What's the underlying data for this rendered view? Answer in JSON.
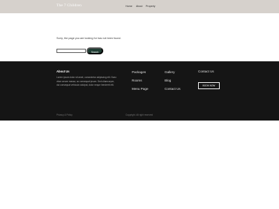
{
  "header": {
    "brand": "The 7 Children",
    "nav": {
      "home": "Home",
      "about": "About",
      "property": "Property"
    }
  },
  "main": {
    "not_found_message": "Sorry, the page you are looking for has not been found.",
    "search_button": "Search",
    "search_value": ""
  },
  "footer": {
    "about_title": "About Us",
    "about_text": "Lorem ipsum dolor sit amet, consectetur adipiscing elit. Nunc vitae ornare massa, ac consequat ipsum. Sed ullamcorper, dui consequat vehicula volutpat, dolor neque hendrerit elit.",
    "links_col1": {
      "packages": "Packages",
      "rooms": "Rooms",
      "menu": "Menu Page"
    },
    "links_col2": {
      "gallery": "Gallery",
      "blog": "Blog",
      "contact": "Contact Us"
    },
    "contact_title": "Contact Us",
    "book_now": "BOOK NOW",
    "privacy": "Privacy & Policy",
    "copyright": "Copyright. All right reserved"
  },
  "colors": {
    "header_bg": "#d6d1cc",
    "footer_bg": "#151515",
    "search_button_bg": "#1f3d33"
  }
}
